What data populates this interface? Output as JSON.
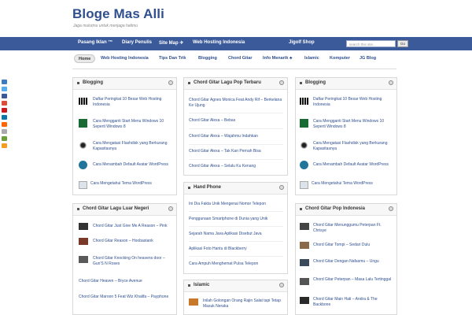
{
  "site": {
    "title": "Bloge Mas Alli",
    "tagline": "Jaga mulutmu untuk menjaga hatimu"
  },
  "topnav": [
    {
      "label": "Pasang Iklan ™",
      "style": "normal"
    },
    {
      "label": "Diary Penulis",
      "style": "normal"
    },
    {
      "label": "Site Map ✈",
      "style": "normal"
    },
    {
      "label": "Web Hosting Indonesia",
      "style": "normal"
    },
    {
      "label": "Jigolf Shop",
      "style": "normal"
    }
  ],
  "search": {
    "placeholder": "search this site...",
    "button": "Go"
  },
  "subnav": [
    {
      "label": "Home"
    },
    {
      "label": "Web Hosting Indonesia"
    },
    {
      "label": "Tips Dan Trik"
    },
    {
      "label": "Blogging"
    },
    {
      "label": "Chord Gitar"
    },
    {
      "label": "Info Menarik ♣"
    },
    {
      "label": "Islamic"
    },
    {
      "label": "Komputer"
    },
    {
      "label": "JG Blog"
    }
  ],
  "colors": {
    "nav": "#3b5a9a",
    "link": "#2f4f8f",
    "title": "#2f4f8f"
  },
  "widgets": {
    "blogging_left": {
      "title": "Blogging",
      "entries": [
        {
          "text": "Daftar Peringkat 10 Besar Web Hosting Indonesia",
          "icon": "stripes-thumb"
        },
        {
          "text": "Cara Mengganti Start Menu Windows 10 Seperti Windows 8",
          "icon": "windows-thumb"
        },
        {
          "text": "Cara Mengatasi Flashdisk yang Berkurang Kapasitasnya",
          "icon": "flashdisk-thumb"
        },
        {
          "text": "Cara Menambah Default Avatar WordPress",
          "icon": "wordpress-thumb"
        },
        {
          "text": "Cara Mengetahui Tema WordPress",
          "icon": "laptop-thumb"
        }
      ]
    },
    "chord_lagu_pop_terbaru": {
      "title": "Chord Gitar Lagu Pop Terbaru",
      "entries": [
        {
          "text": "Chord Gitar Agnes Monica Feat Andy Rif – Berkelana Ke Ujung"
        },
        {
          "text": "Chord Gitar Alexa – Bebas"
        },
        {
          "text": "Chord Gitar Alexa – Wajahmu Indahkan"
        },
        {
          "text": "Chord Gitar Alexa – Tak Kan Pernah Bisa"
        },
        {
          "text": "Chord Gitar Alexa – Selalu Ku Kenang"
        }
      ]
    },
    "blogging_right": {
      "title": "Blogging",
      "entries": [
        {
          "text": "Daftar Peringkat 10 Besar Web Hosting Indonesia",
          "icon": "stripes-thumb"
        },
        {
          "text": "Cara Mengganti Start Menu Windows 10 Seperti Windows 8",
          "icon": "windows-thumb"
        },
        {
          "text": "Cara Mengatasi Flashdisk yang Berkurang Kapasitasnya",
          "icon": "flashdisk-thumb"
        },
        {
          "text": "Cara Menambah Default Avatar WordPress",
          "icon": "wordpress-thumb"
        },
        {
          "text": "Cara Mengetahui Tema WordPress",
          "icon": "laptop-thumb"
        }
      ]
    },
    "hand_phone": {
      "title": "Hand Phone",
      "entries": [
        {
          "text": "Ini Dia Fakta Unik Mengenai Nomor Telepon"
        },
        {
          "text": "Penggunaan Smartphone di Dunia yang Unik"
        },
        {
          "text": "Sejarah Nama Java Aplikasi Disebut Java"
        },
        {
          "text": "Aplikasi Foto Hantu di Blackberry"
        },
        {
          "text": "Cara Ampuh Menghemat Pulsa Telepon"
        }
      ]
    },
    "chord_luar_negeri": {
      "title": "Chord Gitar Lagu Luar Negeri",
      "entries": [
        {
          "text": "Chord Gitar Just Give Me A Reason – Pink",
          "icon": "album-thumb"
        },
        {
          "text": "Chord Gitar Reason – Hoobastank",
          "icon": "album-thumb"
        },
        {
          "text": "Chord Gitar Knocking On heavens door – Gun'S N Roses",
          "icon": "album-thumb"
        },
        {
          "text": "Chord Gitar Heaven – Bryce Avenue",
          "icon": ""
        },
        {
          "text": "Chord Gitar Maroon 5 Feat Wiz Khalifa – Payphone",
          "icon": ""
        }
      ]
    },
    "islamic": {
      "title": "Islamic",
      "entries": [
        {
          "text": "Inilah Golongan Orang Rajin Salat tapi Tetap Masuk Neraka",
          "icon": "mosque-thumb"
        }
      ]
    },
    "chord_pop_indonesia": {
      "title": "Chord Gitar Pop Indonesia",
      "entries": [
        {
          "text": "Chord Gitar Menunggumu Peterpan Ft. Chrisye",
          "icon": "album-thumb"
        },
        {
          "text": "Chord Gitar Tompi – Sedari Dulu",
          "icon": "album-thumb"
        },
        {
          "text": "Chord Gitar Dengan Nafasmu – Ungu",
          "icon": "album-thumb"
        },
        {
          "text": "Chord Gitar Peterpan – Masa Lalu Tertinggal",
          "icon": "album-thumb"
        },
        {
          "text": "Chord Gitar Main Hati – Andra & The Backbone",
          "icon": "album-thumb"
        }
      ]
    }
  }
}
